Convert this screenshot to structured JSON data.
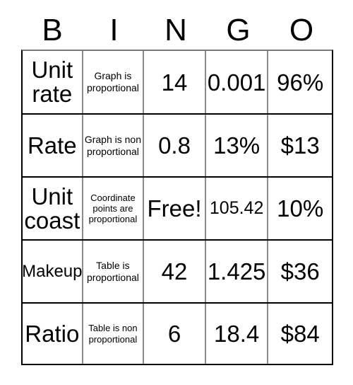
{
  "card": {
    "title": "BINGO card",
    "headers": [
      "B",
      "I",
      "N",
      "G",
      "O"
    ],
    "rows": [
      [
        {
          "text": "Unit rate",
          "size": "big"
        },
        {
          "text": "Graph is proportional",
          "size": "small"
        },
        {
          "text": "14",
          "size": "num"
        },
        {
          "text": "0.001",
          "size": "num"
        },
        {
          "text": "96%",
          "size": "num"
        }
      ],
      [
        {
          "text": "Rate",
          "size": "big"
        },
        {
          "text": "Graph is non proportional",
          "size": "small"
        },
        {
          "text": "0.8",
          "size": "num"
        },
        {
          "text": "13%",
          "size": "num"
        },
        {
          "text": "$13",
          "size": "num"
        }
      ],
      [
        {
          "text": "Unit coast",
          "size": "big"
        },
        {
          "text": "Coordinate points are proportional",
          "size": "xsmall"
        },
        {
          "text": "Free!",
          "size": "num"
        },
        {
          "text": "105.42",
          "size": "numsm"
        },
        {
          "text": "10%",
          "size": "num"
        }
      ],
      [
        {
          "text": "Makeup",
          "size": "name"
        },
        {
          "text": "Table is proportional",
          "size": "small"
        },
        {
          "text": "42",
          "size": "num"
        },
        {
          "text": "1.425",
          "size": "num"
        },
        {
          "text": "$36",
          "size": "num"
        }
      ],
      [
        {
          "text": "Ratio",
          "size": "big"
        },
        {
          "text": "Table is non proportional",
          "size": "xsmall"
        },
        {
          "text": "6",
          "size": "num"
        },
        {
          "text": "18.4",
          "size": "num"
        },
        {
          "text": "$84",
          "size": "num"
        }
      ]
    ],
    "free_space": {
      "row": 2,
      "col": 2,
      "label": "Free!"
    },
    "colors": {
      "background": "#ffffff",
      "text": "#000000",
      "row_border": "#000000",
      "column_border": "#8c8c8c"
    }
  }
}
